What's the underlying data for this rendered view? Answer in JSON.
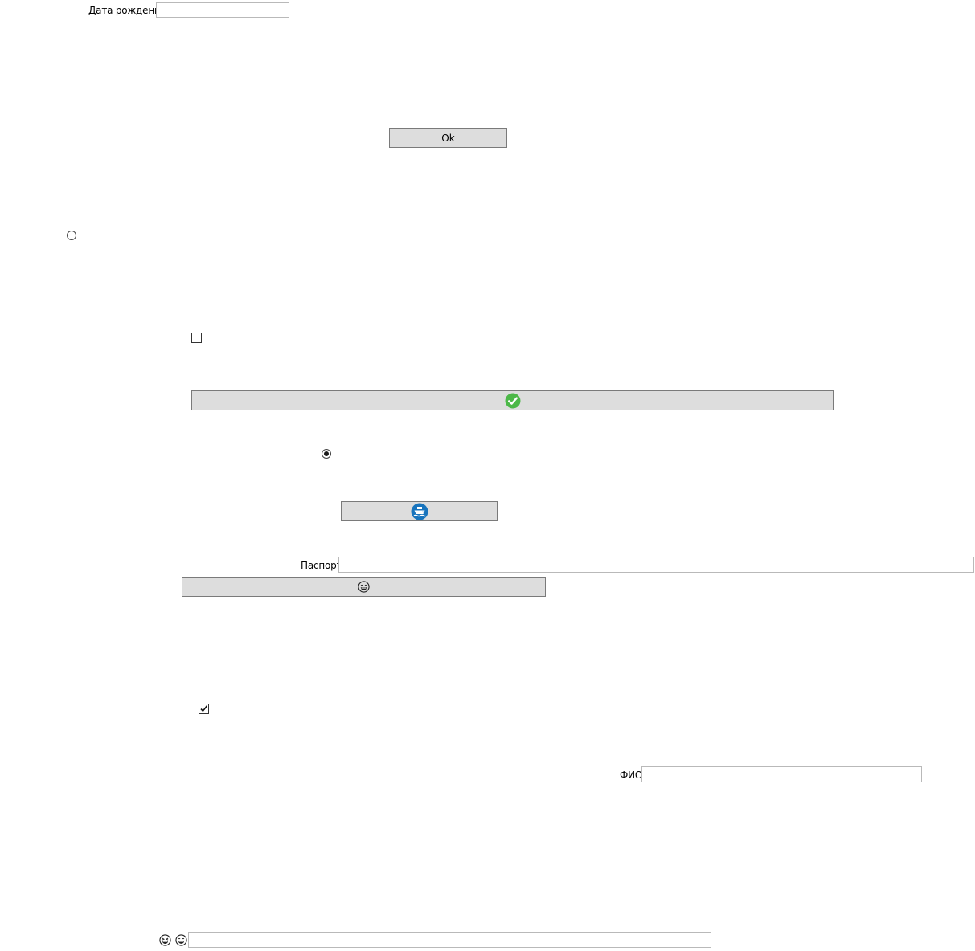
{
  "fields": {
    "birth_date": {
      "label": "Дата рождения",
      "value": ""
    },
    "passport": {
      "label": "Паспорт",
      "value": ""
    },
    "full_name": {
      "label": "ФИО",
      "value": ""
    },
    "bottom_input": {
      "value": ""
    }
  },
  "buttons": {
    "ok": {
      "label": "Ok"
    },
    "check": {
      "icon": "green-check-circle-icon",
      "accent": "#4cb848"
    },
    "ship": {
      "icon": "blue-ship-circle-icon",
      "accent": "#1874bd"
    },
    "smiley": {
      "icon": "grinning-face-icon"
    }
  },
  "controls": {
    "radio_top": {
      "checked": false
    },
    "radio_middle": {
      "checked": true
    },
    "checkbox_top": {
      "checked": false
    },
    "checkbox_bottom": {
      "checked": true
    }
  },
  "bottom_icons": [
    "laughing-face-icon",
    "grinning-face-icon"
  ]
}
